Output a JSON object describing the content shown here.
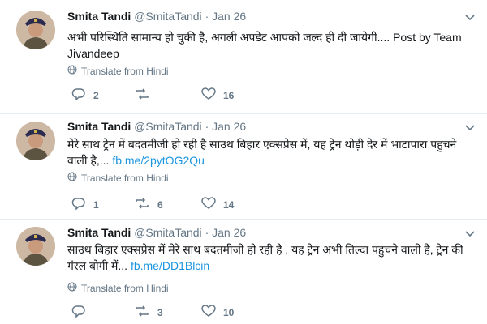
{
  "tweets": [
    {
      "name": "Smita Tandi",
      "handle": "@SmitaTandi",
      "separator": "·",
      "date": "Jan 26",
      "text": "अभी परिस्थिति सामान्य हो चुकी है, अगली अपडेट आपको जल्द ही दी जायेगी.... Post by Team Jivandeep",
      "link": "",
      "translate": "Translate from Hindi",
      "replies": "2",
      "retweets": "",
      "likes": "16"
    },
    {
      "name": "Smita Tandi",
      "handle": "@SmitaTandi",
      "separator": "·",
      "date": "Jan 26",
      "text": "मेरे साथ  ट्रेन में बदतमीजी हो रही है साउथ बिहार एक्सप्रेस में, यह ट्रेन थोड़ी देर में भाटापारा पहुचने वाली है,... ",
      "link": "fb.me/2pytOG2Qu",
      "translate": "Translate from Hindi",
      "replies": "1",
      "retweets": "6",
      "likes": "14"
    },
    {
      "name": "Smita Tandi",
      "handle": "@SmitaTandi",
      "separator": "·",
      "date": "Jan 26",
      "text": "साउथ बिहार एक्सप्रेस में मेरे साथ  बदतमीजी हो रही है , यह ट्रेन अभी तिल्दा पहुचने वाली है, ट्रेन की गंरल बोगी में... ",
      "link": "fb.me/DD1Blcin",
      "translate": "Translate from Hindi",
      "replies": "",
      "retweets": "3",
      "likes": "10"
    }
  ],
  "colors": {
    "text": "#14171a",
    "muted": "#657786",
    "link": "#1b95e0",
    "divider": "#e6ecf0"
  },
  "icons": [
    "avatar",
    "chevron-down-icon",
    "globe-icon",
    "reply-icon",
    "retweet-icon",
    "like-icon"
  ]
}
